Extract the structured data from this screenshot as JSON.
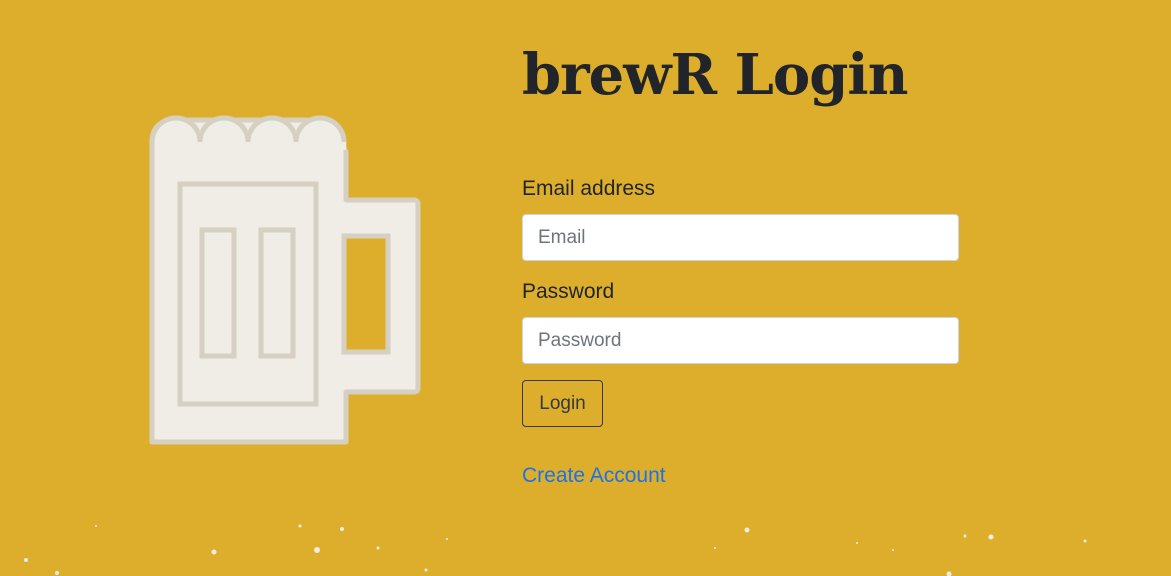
{
  "colors": {
    "background": "#DDAE2B",
    "mug_fill": "#F0EDE6",
    "mug_outline": "#D6D0C2",
    "text": "#212529",
    "link": "#1A73E8"
  },
  "header": {
    "title": "brewR Login"
  },
  "logo": {
    "icon": "beer-mug-icon"
  },
  "form": {
    "email": {
      "label": "Email address",
      "placeholder": "Email",
      "value": ""
    },
    "password": {
      "label": "Password",
      "placeholder": "Password",
      "value": ""
    },
    "login_label": "Login",
    "create_account_label": "Create Account"
  },
  "decoration": {
    "icon": "bubbles-icon"
  }
}
